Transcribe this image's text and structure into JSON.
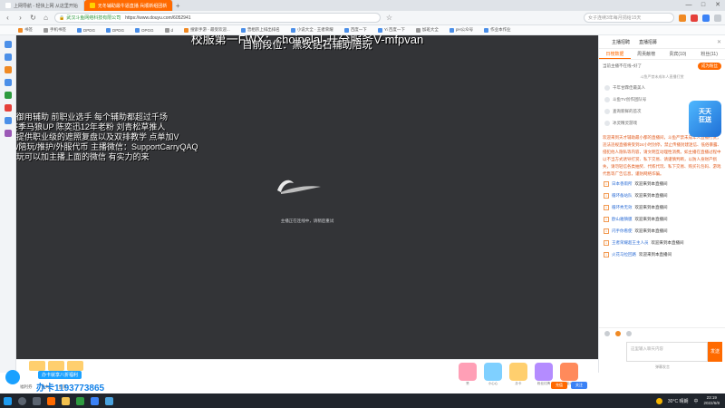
{
  "browser": {
    "tabs": [
      {
        "label": "上网导航 - 轻快上网 从这里开始",
        "active": false
      },
      {
        "label": "无冬辅助最牛逼直播 兵顺新组团新",
        "active": true
      }
    ],
    "new_tab": "+",
    "window_controls": [
      "—",
      "□",
      "✕"
    ],
    "url_host": "武汉斗鱼网络科技有限公司",
    "url": "https://www.douyu.com/6052941",
    "search_placeholder": "女子连续3年每月捐给15天",
    "bookmarks": [
      "书签",
      "手机书签",
      "DPDG",
      "DPDG",
      "OPGG",
      "d",
      "搜索手游 - 最受欢迎...",
      "曾相宗上排出排名",
      "小说大全 - 王者荣耀",
      "百度一下",
      "Yi 百度一下",
      "加班大全",
      "pH公众号",
      "作业本作业",
      "T1 Karl - Summ...",
      "宝贝打开表",
      "百度翻译",
      "聚车本来百年",
      "闲玩电脑",
      "[免费图]免费下载",
      "不可改换"
    ]
  },
  "stream": {
    "overlay_title": "校服第一FWX：choipelal-开分服务V-mfpvan",
    "overlay_rank": "目前段位：黑玫钻石辅助陪玩",
    "overlay_lines": [
      "只玩御用辅助 前职业选手 每个辅助都超过千场",
      "S4赛季马狼UP 陈奕迅12年老粉 刘青松草推人",
      "直播提供职业级的遮照复盘以及双排教学 点单加V",
      "代练/陪玩/推护/外服代币 主播微信：SupportCarryQAQ",
      "想陪玩可以加主播上面的微信 有实力的来"
    ],
    "loading_text": "主播正在连线中，请稍后重试"
  },
  "right_panel": {
    "top_tabs": [
      "主播招聘",
      "直播招募"
    ],
    "tabs": [
      {
        "label": "日榜数据",
        "active": true
      },
      {
        "label": "周贡献榜",
        "active": false
      },
      {
        "label": "贵宾(10)",
        "active": false
      },
      {
        "label": "粉丝(11)",
        "active": false
      }
    ],
    "note": "当前主播不在线~好了",
    "note_button": "成为粉丝",
    "notice": "斗鱼严禁未成年人直播打赏",
    "rank_rows": [
      "千年甘霖佳最美人",
      "斗鱼TV创作团队号",
      "查询新鲜的首次",
      "冰灵精灵游戏"
    ],
    "promo": "天天\n狂送",
    "system_msg": "欢迎来到天才辅助最小都的直播间，斗鱼严禁未成年人直播打赏，违法违规直播将受到24小时封停，禁止传播封建迷信、低俗暴露、侵犯他人隐私等内容，请文明互动理性消费。如主播在直播过程中以不当方式诱导打赏、私下交易、请谨慎判断，以防人身财产损失，请勿轻信各类抽奖、代练代玩、私下交易、购买礼包码、游戏代售等广告信息，谨防网络诈骗。",
    "chat_rows": [
      {
        "lv": "1",
        "user": "日本香雨所",
        "msg": "欢迎来到本直播间"
      },
      {
        "lv": "1",
        "user": "循环备站队",
        "msg": "欢迎来到本直播间"
      },
      {
        "lv": "1",
        "user": "循环秀无效",
        "msg": "欢迎来到本直播间"
      },
      {
        "lv": "1",
        "user": "欧山雅镇膜",
        "msg": "欢迎来到本直播间"
      },
      {
        "lv": "1",
        "user": "闪手你看使",
        "msg": "欢迎来到本直播间"
      },
      {
        "lv": "1",
        "user": "王者荣耀超王主人员",
        "msg": "欢迎来到本直播间"
      },
      {
        "lv": "1",
        "user": "火花马拉回路",
        "msg": "欢迎来到本直播间"
      }
    ],
    "input_placeholder": "这里输入聊天内容",
    "send": "发送",
    "bottom_text": "弹幕发言"
  },
  "gift_bar": {
    "anchor_meta": [
      "福利券",
      "鱼丸",
      "鱼翅"
    ],
    "gifts": [
      "赞",
      "小心心",
      "办卡",
      "粉丝灯牌",
      "超级火箭",
      "飞机"
    ],
    "btn_charge": "充值",
    "btn_follow": "关注"
  },
  "ad": {
    "label": "办卡就享八折福利",
    "phone": "办卡1193773865"
  },
  "taskbar": {
    "weather": "30°C 晴朗",
    "time": "23:19",
    "date": "2022/6/8",
    "lang": "中"
  }
}
